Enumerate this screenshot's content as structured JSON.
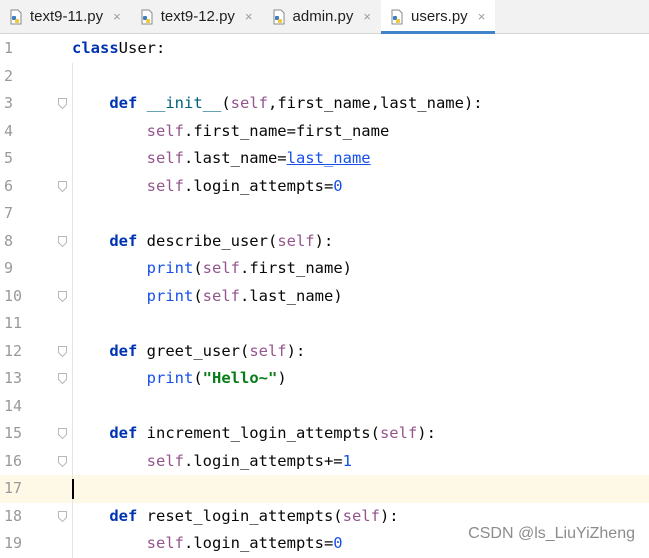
{
  "tabs": [
    {
      "label": "text9-11.py",
      "close": "×",
      "active": false
    },
    {
      "label": "text9-12.py",
      "close": "×",
      "active": false
    },
    {
      "label": "admin.py",
      "close": "×",
      "active": false
    },
    {
      "label": "users.py",
      "close": "×",
      "active": true
    }
  ],
  "icons": {
    "file": "python-file-icon",
    "close": "close-icon",
    "fold": "fold-marker-icon"
  },
  "colors": {
    "keyword": "#0033b3",
    "self": "#94558d",
    "number": "#1750eb",
    "string": "#067d17",
    "current_line": "#fdf9e6",
    "tab_active_underline": "#4083c9"
  },
  "editor": {
    "current_line": 17,
    "lines": [
      {
        "n": "1",
        "tokens": [
          [
            "kw",
            "class"
          ],
          [
            "",
            "User:"
          ]
        ]
      },
      {
        "n": "2",
        "tokens": []
      },
      {
        "n": "3",
        "tokens": [
          [
            "",
            "    "
          ],
          [
            "kw",
            "def"
          ],
          [
            "",
            " "
          ],
          [
            "fn",
            "__init__"
          ],
          [
            "",
            "("
          ],
          [
            "self",
            "self"
          ],
          [
            "",
            ",first_name,last_name):"
          ]
        ]
      },
      {
        "n": "4",
        "tokens": [
          [
            "",
            "        "
          ],
          [
            "self",
            "self"
          ],
          [
            "",
            ".first_name=first_name"
          ]
        ]
      },
      {
        "n": "5",
        "tokens": [
          [
            "",
            "        "
          ],
          [
            "self",
            "self"
          ],
          [
            "",
            ".last_name="
          ],
          [
            "ul",
            "last_name"
          ]
        ]
      },
      {
        "n": "6",
        "tokens": [
          [
            "",
            "        "
          ],
          [
            "self",
            "self"
          ],
          [
            "",
            ".login_attempts="
          ],
          [
            "num",
            "0"
          ]
        ]
      },
      {
        "n": "7",
        "tokens": []
      },
      {
        "n": "8",
        "tokens": [
          [
            "",
            "    "
          ],
          [
            "kw",
            "def"
          ],
          [
            "",
            " describe_user("
          ],
          [
            "self",
            "self"
          ],
          [
            "",
            "):"
          ]
        ]
      },
      {
        "n": "9",
        "tokens": [
          [
            "",
            "        "
          ],
          [
            "num",
            "print"
          ],
          [
            "",
            "("
          ],
          [
            "self",
            "self"
          ],
          [
            "",
            ".first_name)"
          ]
        ]
      },
      {
        "n": "10",
        "tokens": [
          [
            "",
            "        "
          ],
          [
            "num",
            "print"
          ],
          [
            "",
            "("
          ],
          [
            "self",
            "self"
          ],
          [
            "",
            ".last_name)"
          ]
        ]
      },
      {
        "n": "11",
        "tokens": []
      },
      {
        "n": "12",
        "tokens": [
          [
            "",
            "    "
          ],
          [
            "kw",
            "def"
          ],
          [
            "",
            " greet_user("
          ],
          [
            "self",
            "self"
          ],
          [
            "",
            "):"
          ]
        ]
      },
      {
        "n": "13",
        "tokens": [
          [
            "",
            "        "
          ],
          [
            "num",
            "print"
          ],
          [
            "",
            "("
          ],
          [
            "str",
            "\"Hello~\""
          ],
          [
            "",
            ")"
          ]
        ]
      },
      {
        "n": "14",
        "tokens": []
      },
      {
        "n": "15",
        "tokens": [
          [
            "",
            "    "
          ],
          [
            "kw",
            "def"
          ],
          [
            "",
            " increment_login_attempts("
          ],
          [
            "self",
            "self"
          ],
          [
            "",
            "):"
          ]
        ]
      },
      {
        "n": "16",
        "tokens": [
          [
            "",
            "        "
          ],
          [
            "self",
            "self"
          ],
          [
            "",
            ".login_attempts+="
          ],
          [
            "num",
            "1"
          ]
        ]
      },
      {
        "n": "17",
        "tokens": []
      },
      {
        "n": "18",
        "tokens": [
          [
            "",
            "    "
          ],
          [
            "kw",
            "def"
          ],
          [
            "",
            " reset_login_attempts("
          ],
          [
            "self",
            "self"
          ],
          [
            "",
            "):"
          ]
        ]
      },
      {
        "n": "19",
        "tokens": [
          [
            "",
            "        "
          ],
          [
            "self",
            "self"
          ],
          [
            "",
            ".login_attempts="
          ],
          [
            "num",
            "0"
          ]
        ]
      }
    ]
  },
  "watermark": "CSDN @ls_LiuYiZheng"
}
